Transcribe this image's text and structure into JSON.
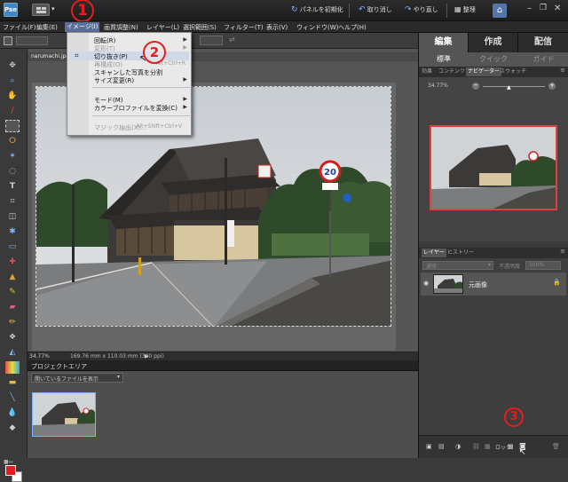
{
  "topbar": {
    "reset_panels": "パネルを初期化",
    "undo": "取り消し",
    "redo": "やり直し",
    "organizer": "整理",
    "callout1": "①"
  },
  "menubar": {
    "items": [
      "ファイル(F)",
      "編集(E)",
      "イメージ(I)",
      "画質調整(N)",
      "レイヤー(L)",
      "選択範囲(S)",
      "フィルター(T)",
      "表示(V)",
      "ウィンドウ(W)",
      "ヘルプ(H)"
    ]
  },
  "dropdown": {
    "items": [
      {
        "label": "回転(R)",
        "disabled": false,
        "submenu": true
      },
      {
        "label": "変形(T)",
        "disabled": true,
        "submenu": true
      },
      {
        "label": "切り抜き(P)",
        "disabled": false,
        "highlight": true
      },
      {
        "label": "再構成(O)",
        "disabled": true,
        "shortcut": "Alt+Ctrl+R"
      },
      {
        "label": "スキャンした写真を分割",
        "disabled": false
      },
      {
        "label": "サイズ変更(R)",
        "disabled": false,
        "submenu": true
      },
      {
        "label": "モード(M)",
        "disabled": false,
        "submenu": true
      },
      {
        "label": "カラーブロファイルを変換(C)",
        "disabled": false,
        "submenu": true
      },
      {
        "label": "マジック抽出(X)...",
        "disabled": true,
        "shortcut": "Alt+Shift+Ctrl+V"
      }
    ],
    "callout2": "2"
  },
  "document": {
    "tab_label": "narumachi.jpg",
    "zoom": "34.77%",
    "dimensions": "169.76 mm x 110.03 mm (300 ppi)",
    "sign_speed": "20"
  },
  "project_area": {
    "title": "プロジェクトエリア",
    "filter": "開いているファイルを表示"
  },
  "right_panel": {
    "tabs": [
      "編集",
      "作成",
      "配信"
    ],
    "subtabs": [
      "標準",
      "クイック",
      "ガイド"
    ],
    "nav_tabs": [
      "効果",
      "コンテンツ",
      "ナビゲーター",
      "スウォッチ"
    ],
    "nav_zoom": "34.77%",
    "layer_tabs": [
      "レイヤー",
      "ヒストリー"
    ],
    "blend_mode": "通常",
    "opacity_label": "不透明度",
    "opacity_value": "100%",
    "layer_name": "元画像",
    "lock_label": "ロック",
    "callout3": "3"
  },
  "colors": {
    "accent": "#e81c1c",
    "menu_highlight": "#5a6f9a",
    "nav_frame": "#e04040"
  }
}
